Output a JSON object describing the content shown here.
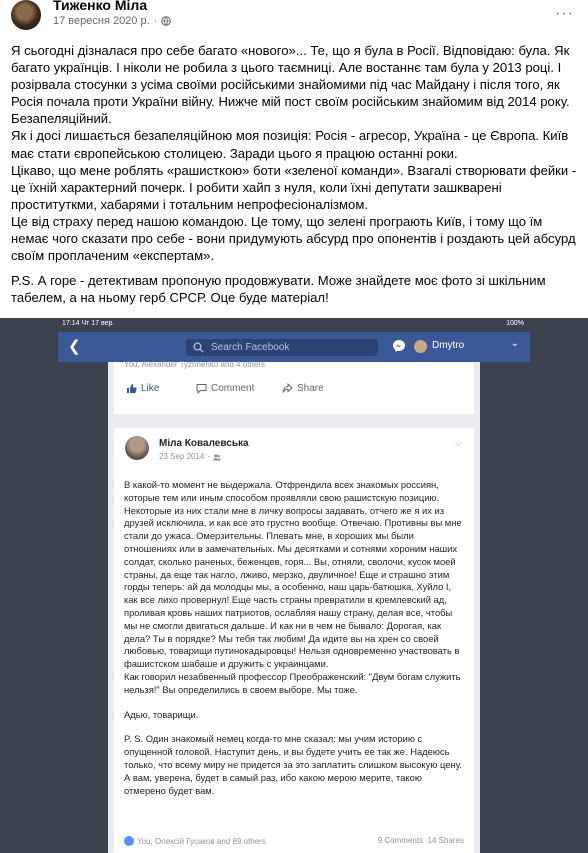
{
  "post": {
    "author": "Тиженко Міла",
    "date": "17 вересня 2020 р.",
    "separator": "·",
    "more": "···",
    "paragraphs": [
      "Я сьогодні дізналася про себе багато «нового»... Те, що я була в Росії. Відповідаю: була. Як багато українців. І ніколи не робила з цього таємниці. Але востаннє там була у 2013 році. І  розірвала стосунки з усіма своїми російськими знайомими під час Майдану і після того, як Росія почала проти України війну. Нижче мій пост своїм російським знайомим від 2014 року. Безапеляційний.",
      "Як і досі лишається безапеляційною моя позиція: Росія - агресор, Україна - це Європа. Київ має стати європейською столицею. Заради цього я працюю останні роки.",
      "Цікаво, що мене роблять «рашисткою» боти «зеленої команди». Взагалі створювати фейки - це їхній характерний почерк. І робити хайп з нуля, коли їхні депутати зашкварені проституткми, хабарями і тотальним непрофесіоналізмом.",
      "Це від страху перед нашою командою. Це тому, що зелені програють Київ, і тому що їм немає чого сказати про себе - вони придумують абсурд про опонентів і роздають цей абсурд своїм проплаченим «експертам».",
      "P.S. А горе - детективам пропоную продовжувати. Може знайдете моє фото зі шкільним табелем, а на ньому герб СРСР. Оце буде матеріал!"
    ]
  },
  "screenshot": {
    "status_left": "17:14  Чт 17 вер.",
    "status_right": "100%",
    "search_placeholder": "Search Facebook",
    "user_name": "Dmytro",
    "prev_post_line": "You, Alexander Tyzhnenko and 4 others",
    "like_label": "Like",
    "comment_label": "Comment",
    "share_label": "Share",
    "card": {
      "author": "Міла Ковалевська",
      "date": "23 Sep 2014",
      "paragraphs": [
        "В какой-то момент не выдержала. Отфрендила всех знакомых россиян, которые тем или иным способом проявляли свою рашистскую позицию. Некоторые из них стали мне в личку вопросы задавать, отчего же я их из друзей исключила, и как все это грустно вообще. Отвечаю. Противны вы мне стали до ужаса. Омерзительны. Плевать мне, в хороших мы были отношениях или в замечательных. Мы десятками и сотнями хороним наших солдат, сколько раненых, беженцев, горя... Вы, отняли, сволочи, кусок моей страны, да еще так нагло, лживо, мерзко, двуличное! Еще и страшно этим горды теперь: ай да молодцы мы, а особенно, наш царь-батюшка, Хуйло І, как все лихо провернул! Еще часть страны превратили в кремлевский ад, проливая кровь наших патриотов, ослабляя нашу страну, делая все, чтобы мы не смогли двигаться дальше. И как ни в чем не бывало: Дорогая, как дела? Ты в порядке? Мы тебя так любим! Да идите вы на хрен со своей любовью, товарищи путинокадыровцы! Нельзя одновременно участвовать в фашистском шабаше и дружить с украинцами.",
        "Как говорил незабвенный профессор Преображенский: \"Двум богам служить нельзя!\" Вы определились в своем выборе. Мы тоже.",
        "Адью, товарищи.",
        "P. S. Один знакомый немец когда-то мне сказал: мы учим историю с опущенной головой. Наступит день, и вы будете учить ее так же. Надеюсь только, что всему миру не придется за это заплатить слишком высокую цену. А вам, уверена, будет в самый раз, ибо какою мерою мерите, такою отмерено будет вам."
      ],
      "reactions_text": "You, Олексій Гусаков and 89 others",
      "comments_count": "9 Comments",
      "shares_count": "14 Shares"
    }
  }
}
